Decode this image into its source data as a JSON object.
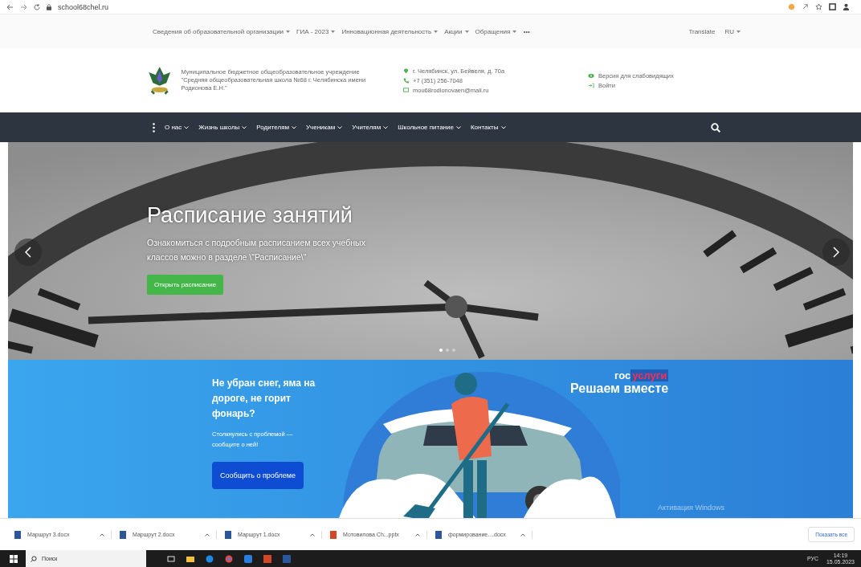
{
  "browser": {
    "url": "school68chel.ru"
  },
  "top_links": [
    {
      "label": "Сведения об образовательной организации",
      "dropdown": true
    },
    {
      "label": "ГИА - 2023",
      "dropdown": true
    },
    {
      "label": "Инновационная деятельность",
      "dropdown": true
    },
    {
      "label": "Акции",
      "dropdown": true
    },
    {
      "label": "Обращения",
      "dropdown": true
    },
    {
      "label": "•••",
      "dropdown": false
    }
  ],
  "translate": {
    "label": "Translate",
    "language": "RU"
  },
  "header": {
    "school_name": "Муниципальное бюджетное общеобразовательное учреждение \"Средняя общеобразовательная школа №68 г. Челябинска имени Родионова Е.Н.\"",
    "contacts": [
      {
        "kind": "address",
        "text": "г. Челябинск, ул. Бейвеля, д. 70а"
      },
      {
        "kind": "phone",
        "text": "+7 (351) 256-7048"
      },
      {
        "kind": "email",
        "text": "mou68rodionovaen@mail.ru"
      }
    ],
    "links": [
      {
        "kind": "eye",
        "text": "Версия для слабовидящих"
      },
      {
        "kind": "login",
        "text": "Войти"
      }
    ]
  },
  "nav": [
    "О нас",
    "Жизнь школы",
    "Родителям",
    "Ученикам",
    "Учителям",
    "Школьное питание",
    "Контакты"
  ],
  "hero": {
    "title": "Расписание занятий",
    "text": "Ознакомиться с подробным расписанием всех учебных классов можно в разделе \\\"Расписание\\\"",
    "button": "Открыть расписание",
    "indicators": [
      {
        "selected": true
      },
      {
        "selected": false
      },
      {
        "selected": false
      }
    ]
  },
  "banner": {
    "title": "Не убран снег, яма на дороге, не горит фонарь?",
    "text": "Столкнулись с проблемой — сообщите о ней!",
    "button": "Сообщить о проблеме",
    "logo_part1": "гос",
    "logo_part2": "услуги",
    "slogan": "Решаем вместе",
    "os_notice": "Активация Windows"
  },
  "downloads": {
    "items": [
      {
        "name": "Маршрут 3.docx",
        "kind": "doc"
      },
      {
        "name": "Маршрут 2.docx",
        "kind": "doc"
      },
      {
        "name": "Маршрут 1.docx",
        "kind": "doc"
      },
      {
        "name": "Мотовилова Ch...pptx",
        "kind": "ppt"
      },
      {
        "name": "формирование....docx",
        "kind": "doc"
      }
    ],
    "show_all": "Показать все"
  },
  "taskbar": {
    "search": "Поиск",
    "lang": "РУС",
    "time": "14:19",
    "date": "15.05.2023"
  }
}
